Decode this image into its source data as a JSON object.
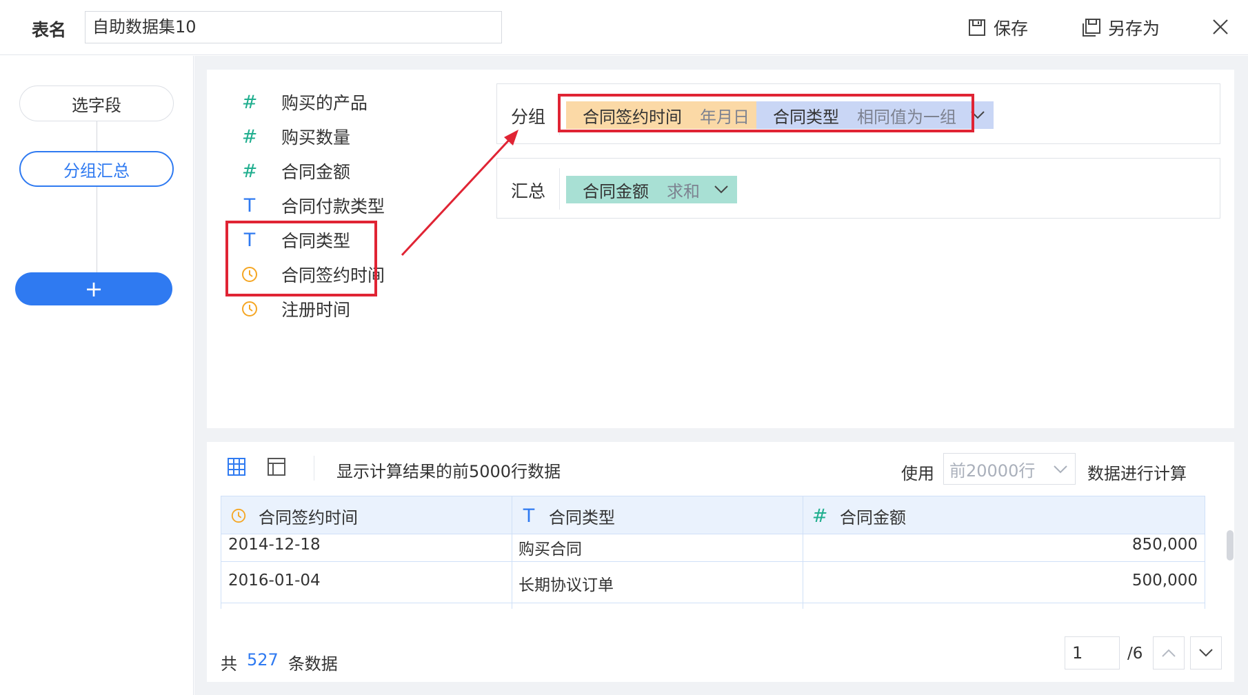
{
  "header": {
    "table_name_label": "表名",
    "table_name_value": "自助数据集10",
    "save_label": "保存",
    "save_as_label": "另存为"
  },
  "steps": {
    "select_fields": "选字段",
    "group_summary": "分组汇总",
    "add": "+"
  },
  "fields": [
    {
      "type": "number",
      "icon": "#",
      "label": "购买的产品"
    },
    {
      "type": "number",
      "icon": "#",
      "label": "购买数量"
    },
    {
      "type": "number",
      "icon": "#",
      "label": "合同金额"
    },
    {
      "type": "text",
      "icon": "T",
      "label": "合同付款类型"
    },
    {
      "type": "text",
      "icon": "T",
      "label": "合同类型"
    },
    {
      "type": "date",
      "icon": "clock",
      "label": "合同签约时间"
    },
    {
      "type": "date",
      "icon": "clock",
      "label": "注册时间"
    }
  ],
  "group_zone": {
    "label": "分组",
    "chips": [
      {
        "name": "合同签约时间",
        "mode": "年月日",
        "color": "#fbd9a6"
      },
      {
        "name": "合同类型",
        "mode": "相同值为一组",
        "color": "#c9d6f5"
      }
    ]
  },
  "summary_zone": {
    "label": "汇总",
    "chips": [
      {
        "name": "合同金额",
        "mode": "求和",
        "color": "#a8e0d4"
      }
    ]
  },
  "preview": {
    "description": "显示计算结果的前5000行数据",
    "use_label": "使用",
    "row_limit_select": "前20000行",
    "calc_label": "数据进行计算",
    "columns": [
      {
        "type": "date",
        "label": "合同签约时间"
      },
      {
        "type": "text",
        "label": "合同类型"
      },
      {
        "type": "number",
        "label": "合同金额"
      }
    ],
    "rows": [
      [
        "2014-12-18",
        "购买合同",
        "850,000"
      ],
      [
        "2016-01-04",
        "长期协议订单",
        "500,000"
      ]
    ],
    "total_prefix": "共",
    "total_count": "527",
    "total_suffix": "条数据",
    "page_current": "1",
    "page_total": "/6"
  },
  "colors": {
    "accent": "#2f7af1",
    "highlight_red": "#e02434",
    "number_icon": "#1fae8e",
    "date_icon": "#f5a623"
  }
}
